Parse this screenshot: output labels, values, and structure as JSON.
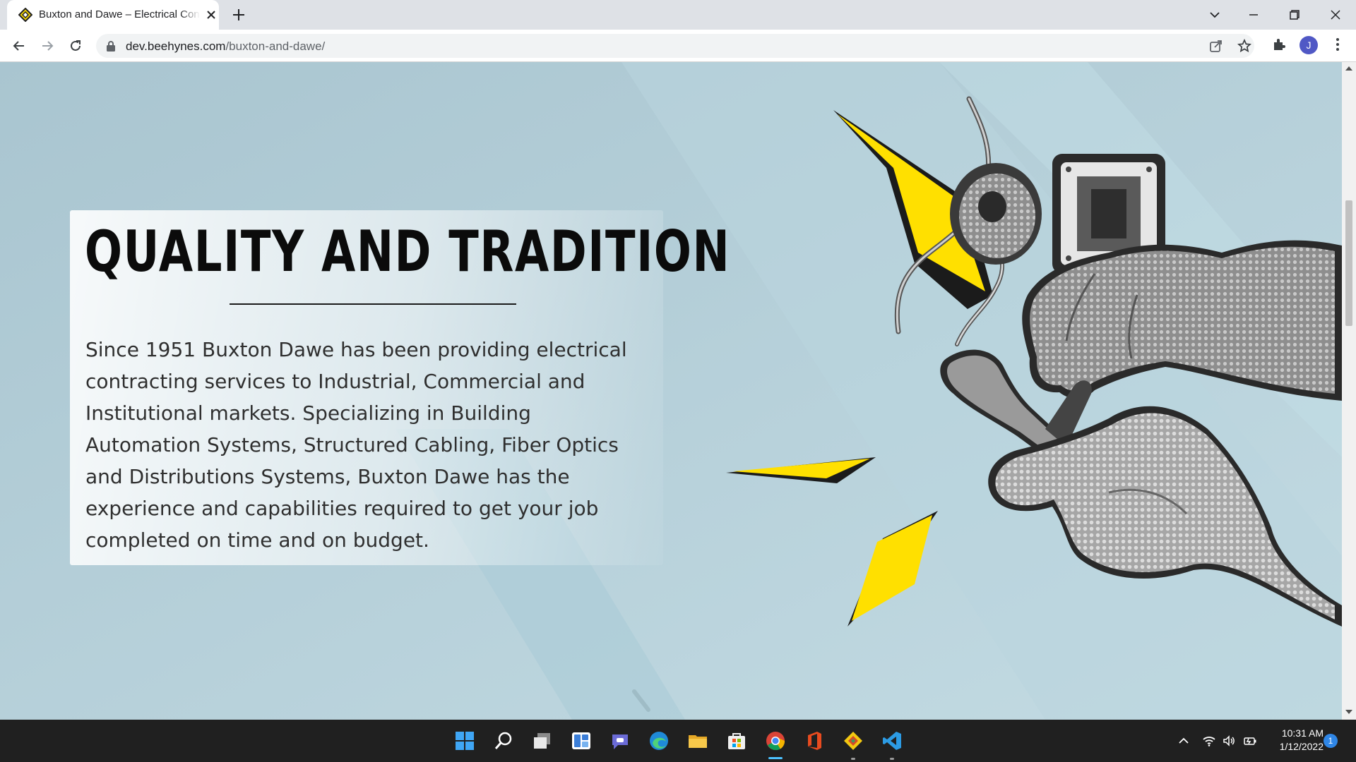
{
  "browser": {
    "tab_title": "Buxton and Dawe – Electrical Contractors",
    "url_host": "dev.beehynes.com",
    "url_path": "/buxton-and-dawe/",
    "profile_initial": "J"
  },
  "hero": {
    "heading": "QUALITY AND TRADITION",
    "body": "Since 1951 Buxton Dawe has been providing electrical contracting services to Industrial, Commercial and Institutional markets. Specializing in Building Automation Systems, Structured Cabling, Fiber Optics and Distributions Systems, Buxton Dawe has the experience and capabilities required to get your job completed on time and on budget."
  },
  "taskbar": {
    "apps": [
      "start-icon",
      "search-icon",
      "task-view-icon",
      "widgets-icon",
      "teams-chat-icon",
      "edge-icon",
      "file-explorer-icon",
      "store-icon",
      "chrome-icon",
      "office-icon",
      "git-icon",
      "vscode-icon"
    ],
    "clock_time": "10:31 AM",
    "clock_date": "1/12/2022",
    "notification_count": "1"
  },
  "colors": {
    "page_background": "#b8d3dd",
    "accent_yellow": "#ffe000",
    "taskbar": "#202020"
  }
}
